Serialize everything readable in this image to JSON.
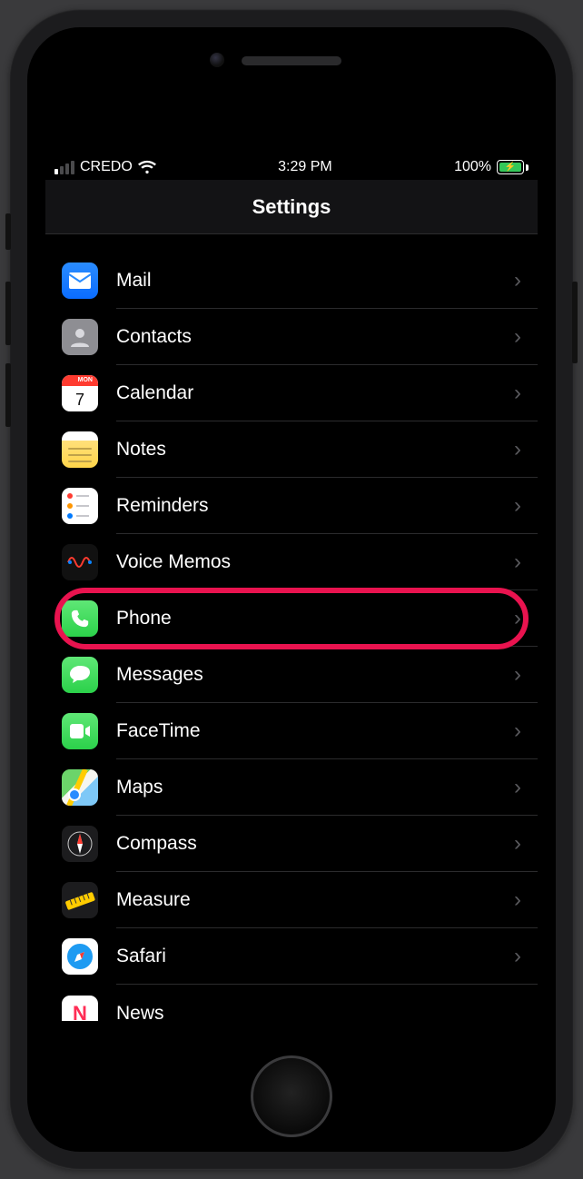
{
  "statusbar": {
    "carrier": "CREDO",
    "time": "3:29 PM",
    "battery_pct": "100%"
  },
  "nav": {
    "title": "Settings"
  },
  "items": [
    {
      "id": "mail",
      "label": "Mail",
      "icon": "mail-icon"
    },
    {
      "id": "contacts",
      "label": "Contacts",
      "icon": "contacts-icon"
    },
    {
      "id": "calendar",
      "label": "Calendar",
      "icon": "calendar-icon"
    },
    {
      "id": "notes",
      "label": "Notes",
      "icon": "notes-icon"
    },
    {
      "id": "reminders",
      "label": "Reminders",
      "icon": "reminders-icon"
    },
    {
      "id": "voicememos",
      "label": "Voice Memos",
      "icon": "voice-memos-icon"
    },
    {
      "id": "phone",
      "label": "Phone",
      "icon": "phone-icon",
      "highlighted": true
    },
    {
      "id": "messages",
      "label": "Messages",
      "icon": "messages-icon"
    },
    {
      "id": "facetime",
      "label": "FaceTime",
      "icon": "facetime-icon"
    },
    {
      "id": "maps",
      "label": "Maps",
      "icon": "maps-icon"
    },
    {
      "id": "compass",
      "label": "Compass",
      "icon": "compass-icon"
    },
    {
      "id": "measure",
      "label": "Measure",
      "icon": "measure-icon"
    },
    {
      "id": "safari",
      "label": "Safari",
      "icon": "safari-icon"
    },
    {
      "id": "news",
      "label": "News",
      "icon": "news-icon",
      "cutoff": true
    }
  ],
  "calendar_icon": {
    "day_label": "MON",
    "day_num": "7"
  }
}
